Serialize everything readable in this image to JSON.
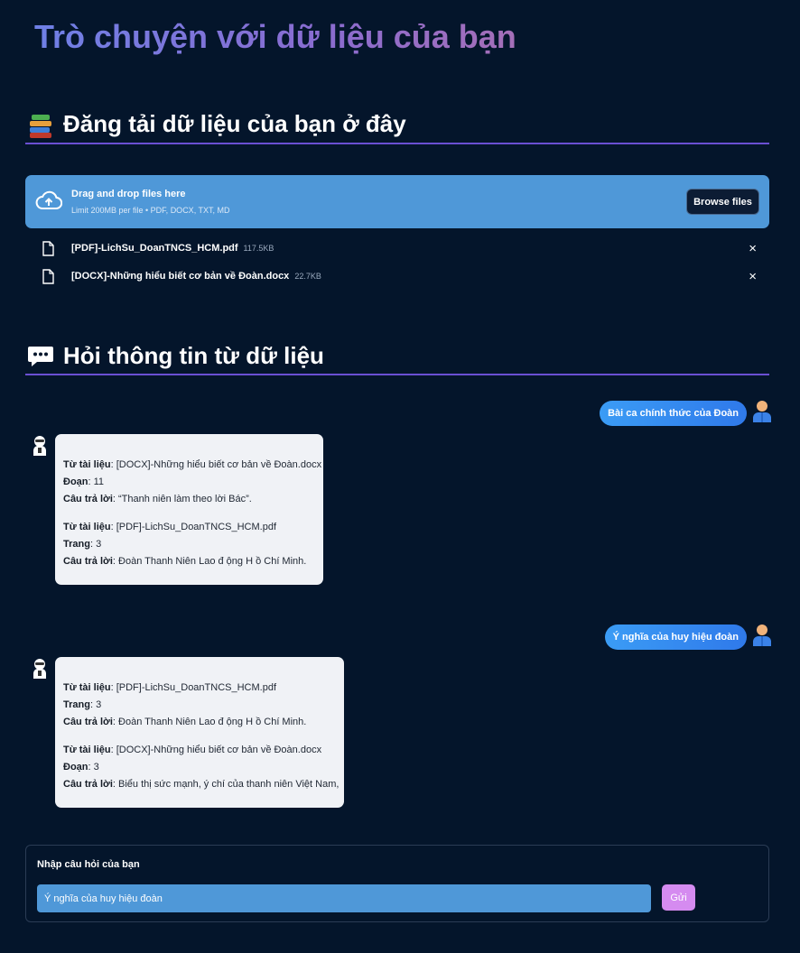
{
  "app": {
    "title": "Trò chuyện với dữ liệu của bạn"
  },
  "upload_section": {
    "title": "Đăng tải dữ liệu của bạn ở đây",
    "icon": "books-icon",
    "dropzone": {
      "main_text": "Drag and drop files here",
      "sub_text": "Limit 200MB per file • PDF, DOCX, TXT, MD",
      "browse_label": "Browse files"
    },
    "files": [
      {
        "name": "[PDF]-LichSu_DoanTNCS_HCM.pdf",
        "size": "117.5KB",
        "remove": "×"
      },
      {
        "name": "[DOCX]-Những hiểu biết cơ bản về Đoàn.docx",
        "size": "22.7KB",
        "remove": "×"
      }
    ]
  },
  "chat_section": {
    "title": "Hỏi thông tin từ dữ liệu",
    "icon": "speech-bubble-icon",
    "messages": [
      {
        "role": "user",
        "text": "Bài ca chính thức của Đoàn"
      },
      {
        "role": "assistant",
        "blocks": [
          {
            "source_label": "Từ tài liệu",
            "source": "[DOCX]-Những hiểu biết cơ bản về Đoàn.docx",
            "loc_label": "Đoạn",
            "loc": "11",
            "answer_label": "Câu trả lời",
            "answer": "“Thanh niên làm theo lời Bác”."
          },
          {
            "source_label": "Từ tài liệu",
            "source": "[PDF]-LichSu_DoanTNCS_HCM.pdf",
            "loc_label": "Trang",
            "loc": "3",
            "answer_label": "Câu trả lời",
            "answer": "Đoàn Thanh Niên Lao đ ộng H ồ Chí Minh."
          }
        ]
      },
      {
        "role": "user",
        "text": "Ý nghĩa của huy hiệu đoàn"
      },
      {
        "role": "assistant",
        "blocks": [
          {
            "source_label": "Từ tài liệu",
            "source": "[PDF]-LichSu_DoanTNCS_HCM.pdf",
            "loc_label": "Trang",
            "loc": "3",
            "answer_label": "Câu trả lời",
            "answer": "Đoàn Thanh Niên Lao đ ộng H ồ Chí Minh."
          },
          {
            "source_label": "Từ tài liệu",
            "source": "[DOCX]-Những hiểu biết cơ bản về Đoàn.docx",
            "loc_label": "Đoạn",
            "loc": "3",
            "answer_label": "Câu trả lời",
            "answer": "Biểu thị sức mạnh, ý chí của thanh niên Việt Nam,"
          }
        ]
      }
    ]
  },
  "form": {
    "label": "Nhập câu hỏi của bạn",
    "input_value": "Ý nghĩa của huy hiệu đoàn",
    "send_label": "Gửi"
  },
  "colors": {
    "background": "#04152b",
    "accent_divider": "#6a4fd3",
    "dropzone": "#4f98d8",
    "user_bubble": "#3b9cf5",
    "send_button": "#d58bf0"
  }
}
